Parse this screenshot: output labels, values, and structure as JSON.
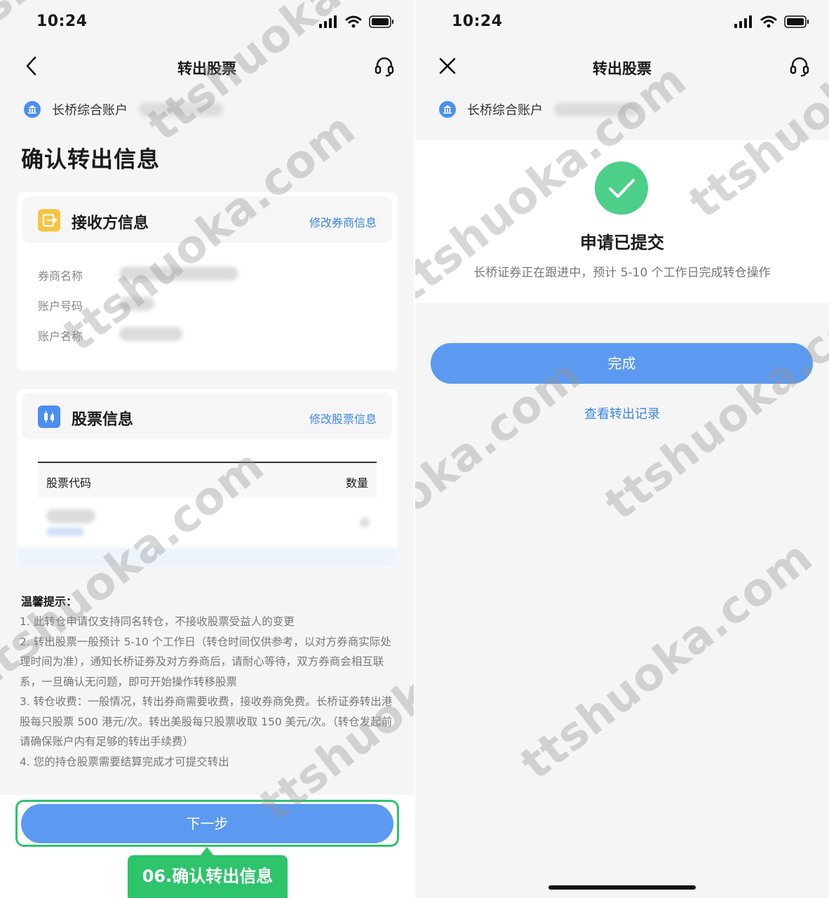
{
  "left_screen": {
    "status_bar": {
      "time": "10:24"
    },
    "nav": {
      "title": "转出股票"
    },
    "account": {
      "label": "长桥综合账户"
    },
    "heading": "确认转出信息",
    "receiver_card": {
      "title": "接收方信息",
      "edit_link": "修改券商信息",
      "fields": [
        {
          "label": "券商名称"
        },
        {
          "label": "账户号码"
        },
        {
          "label": "账户名称"
        }
      ]
    },
    "stock_card": {
      "title": "股票信息",
      "edit_link": "修改股票信息",
      "table": {
        "col_code": "股票代码",
        "col_qty": "数量"
      }
    },
    "tips": {
      "title": "温馨提示：",
      "items": [
        "1. 此转仓申请仅支持同名转仓，不接收股票受益人的变更",
        "2. 转出股票一般预计 5-10 个工作日（转仓时间仅供参考，以对方券商实际处理时间为准），通知长桥证券及对方券商后，请耐心等待，双方券商会相互联系，一旦确认无问题，即可开始操作转移股票",
        "3. 转仓收费：一般情况，转出券商需要收费，接收券商免费。长桥证券转出港股每只股票 500 港元/次。转出美股每只股票收取 150 美元/次。（转仓发起前请确保账户内有足够的转出手续费）",
        "4. 您的持仓股票需要结算完成才可提交转出"
      ]
    },
    "next_button": "下一步",
    "callout": "06.确认转出信息"
  },
  "right_screen": {
    "status_bar": {
      "time": "10:24"
    },
    "nav": {
      "title": "转出股票"
    },
    "account": {
      "label": "长桥综合账户"
    },
    "success": {
      "title": "申请已提交",
      "subtitle": "长桥证券正在跟进中，预计 5-10 个工作日完成转仓操作"
    },
    "done_button": "完成",
    "record_link": "查看转出记录"
  },
  "watermark_text": "ttshuoka.com",
  "icons": {
    "back": "chevron-left-icon",
    "close": "close-icon",
    "support": "headset-icon",
    "bank": "bank-icon",
    "receiver": "transfer-out-icon",
    "stock": "candlestick-icon",
    "success": "check-icon"
  },
  "colors": {
    "accent_blue": "#5b9af0",
    "link_blue": "#3b86e6",
    "success_green": "#4ccf88",
    "callout_green": "#2ec46b",
    "receiver_icon": "#f5c542",
    "background": "#f5f5f5"
  }
}
